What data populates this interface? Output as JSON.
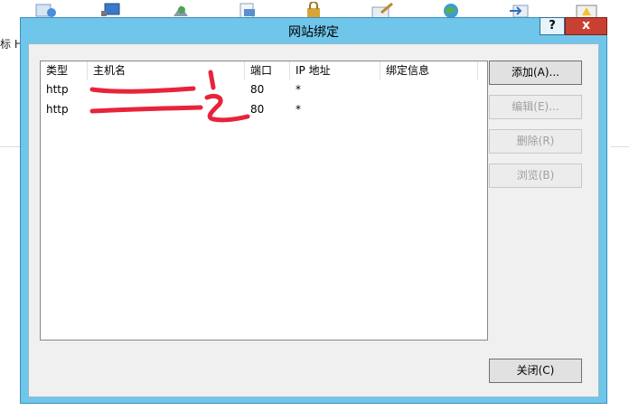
{
  "background": {
    "left_text": "标 H"
  },
  "dialog": {
    "title": "网站绑定",
    "help_label": "?",
    "close_label": "x"
  },
  "bindings": {
    "columns": [
      "类型",
      "主机名",
      "端口",
      "IP 地址",
      "绑定信息"
    ],
    "rows": [
      {
        "type": "http",
        "host": "",
        "port": "80",
        "ip": "*",
        "info": ""
      },
      {
        "type": "http",
        "host": "",
        "port": "80",
        "ip": "*",
        "info": ""
      }
    ]
  },
  "buttons": {
    "add": "添加(A)...",
    "edit": "编辑(E)...",
    "remove": "删除(R)",
    "browse": "浏览(B)",
    "close": "关闭(C)"
  },
  "colors": {
    "titlebar": "#6fc6ea",
    "close_button": "#c84031",
    "redaction": "#e8233a"
  }
}
